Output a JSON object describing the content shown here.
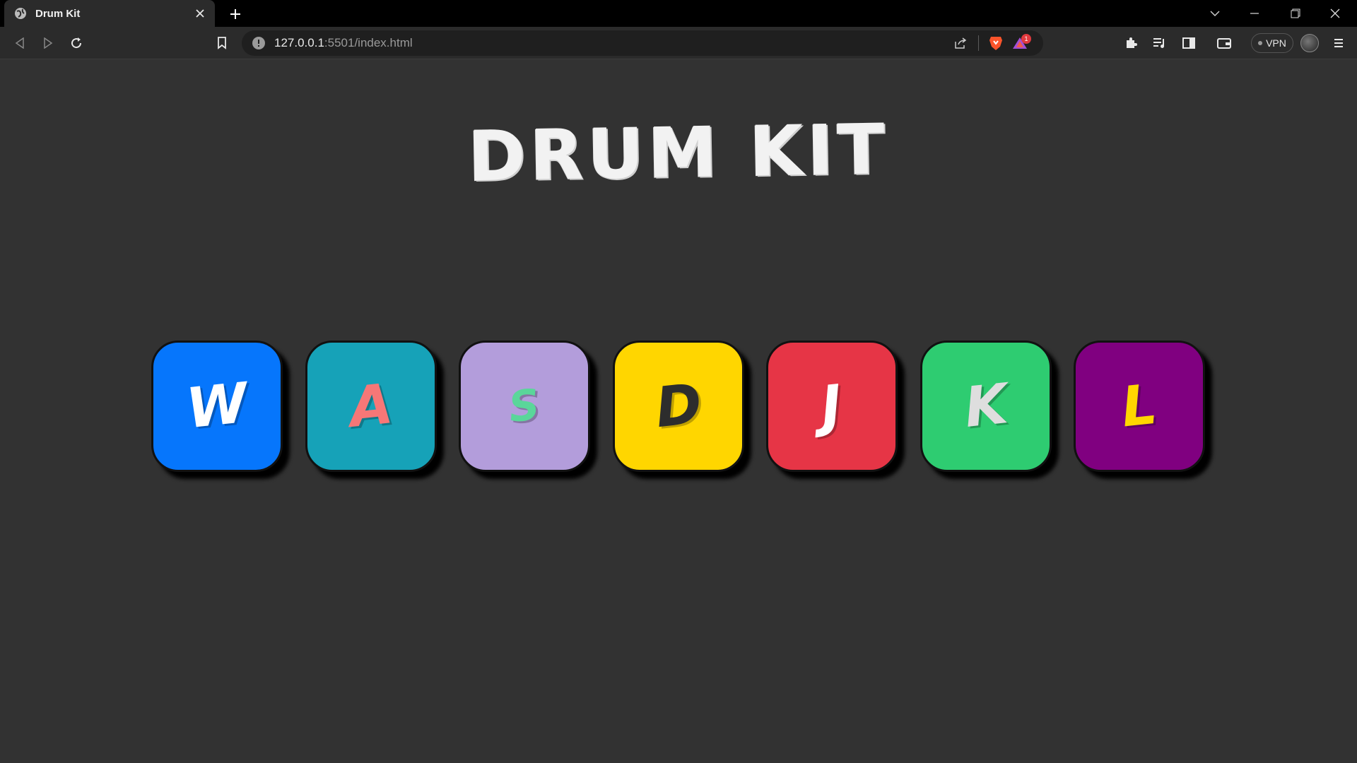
{
  "browser": {
    "tab_title": "Drum Kit",
    "url_host": "127.0.0.1",
    "url_rest": ":5501/index.html",
    "vpn_label": "VPN",
    "notification_count": "1"
  },
  "page": {
    "title": "DRUM KIT"
  },
  "drums": [
    {
      "key": "W",
      "color": "#0676fc",
      "letter_color": "#ffffff"
    },
    {
      "key": "A",
      "color": "#16a2b8",
      "letter_color": "#f67777"
    },
    {
      "key": "S",
      "color": "#b39ddb",
      "letter_color": "#5ad69a"
    },
    {
      "key": "D",
      "color": "#ffd600",
      "letter_color": "#2d2d2d"
    },
    {
      "key": "J",
      "color": "#e63546",
      "letter_color": "#ffffff"
    },
    {
      "key": "K",
      "color": "#2ecc71",
      "letter_color": "#dedede"
    },
    {
      "key": "L",
      "color": "#800080",
      "letter_color": "#ffd600"
    }
  ]
}
